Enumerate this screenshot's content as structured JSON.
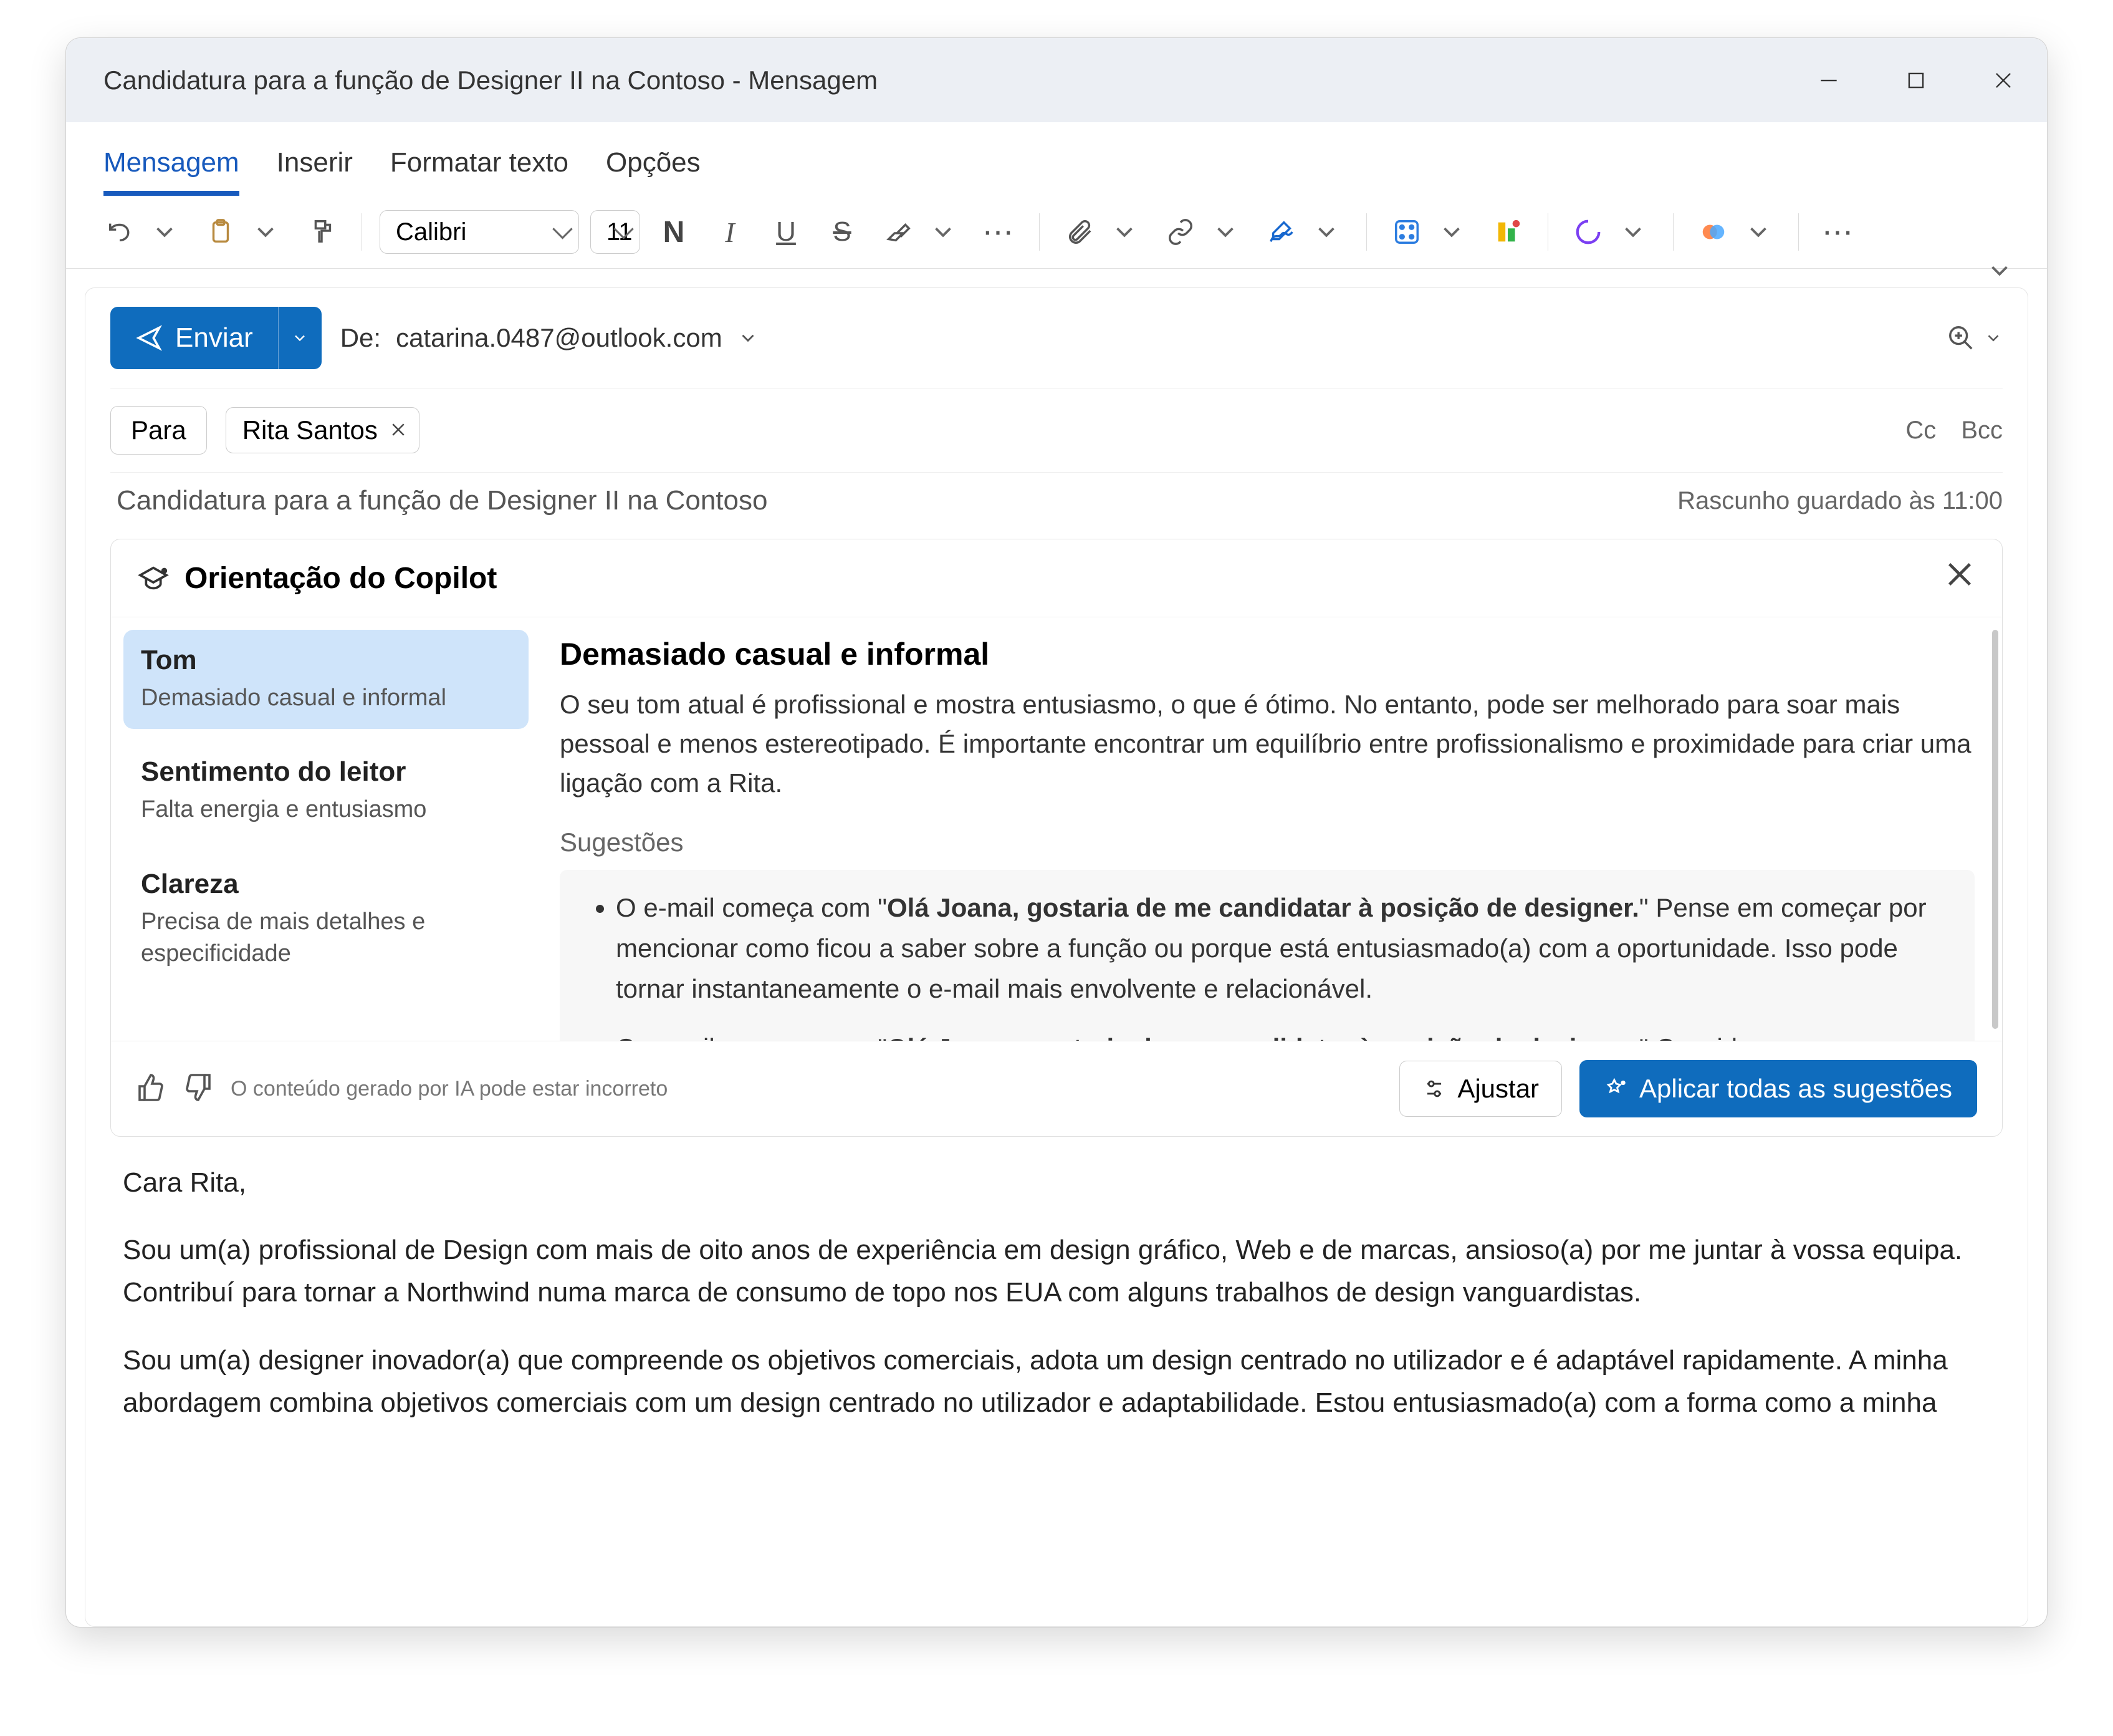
{
  "window": {
    "title": "Candidatura para a função de Designer II na Contoso - Mensagem"
  },
  "tabs": {
    "message": "Mensagem",
    "insert": "Inserir",
    "format": "Formatar texto",
    "options": "Opções"
  },
  "ribbon": {
    "font_name": "Calibri",
    "font_size": "11"
  },
  "compose": {
    "send": "Enviar",
    "from_prefix": "De:",
    "from_email": "catarina.0487@outlook.com",
    "to_label": "Para",
    "recipient": "Rita Santos",
    "cc": "Cc",
    "bcc": "Bcc",
    "subject": "Candidatura para a função de Designer II na Contoso",
    "draft_saved": "Rascunho guardado às 11:00"
  },
  "copilot": {
    "header": "Orientação do Copilot",
    "categories": [
      {
        "title": "Tom",
        "subtitle": "Demasiado casual e informal"
      },
      {
        "title": "Sentimento do leitor",
        "subtitle": "Falta energia e entusiasmo"
      },
      {
        "title": "Clareza",
        "subtitle": "Precisa de mais detalhes e especificidade"
      }
    ],
    "detail_title": "Demasiado casual e informal",
    "detail_body": "O seu tom atual é profissional e mostra entusiasmo, o que é ótimo. No entanto, pode ser melhorado para soar mais pessoal e menos estereotipado. É importante encontrar um equilíbrio entre profissionalismo e proximidade para criar uma ligação com a Rita.",
    "suggestions_label": "Sugestões",
    "suggestions": [
      {
        "lead": "O e-mail começa com \"",
        "bold": "Olá Joana, gostaria de me candidatar à posição de designer.",
        "tail": "\" Pense em começar por mencionar como ficou a saber sobre a função ou porque está entusiasmado(a) com a oportunidade. Isso pode tornar instantaneamente o e-mail mais envolvente e relacionável."
      },
      {
        "lead": "O e-mail começa com \"",
        "bold": "Olá Joana, gostaria de me candidatar à posição de designer.",
        "tail": "\" Considere começar por"
      }
    ],
    "ai_note": "O conteúdo gerado por IA pode estar incorreto",
    "adjust": "Ajustar",
    "apply_all": "Aplicar todas as sugestões"
  },
  "email_body": {
    "p1": "Cara Rita,",
    "p2": "Sou um(a) profissional de Design com mais de oito anos de experiência em design gráfico, Web e de marcas, ansioso(a) por me juntar à vossa equipa. Contribuí para tornar a Northwind numa marca de consumo de topo nos EUA com alguns trabalhos de design vanguardistas.",
    "p3": "Sou um(a) designer inovador(a) que compreende os objetivos comerciais, adota um design centrado no utilizador e é adaptável rapidamente. A minha abordagem combina objetivos comerciais com um design centrado no utilizador e adaptabilidade. Estou entusiasmado(a) com a forma como a minha"
  }
}
